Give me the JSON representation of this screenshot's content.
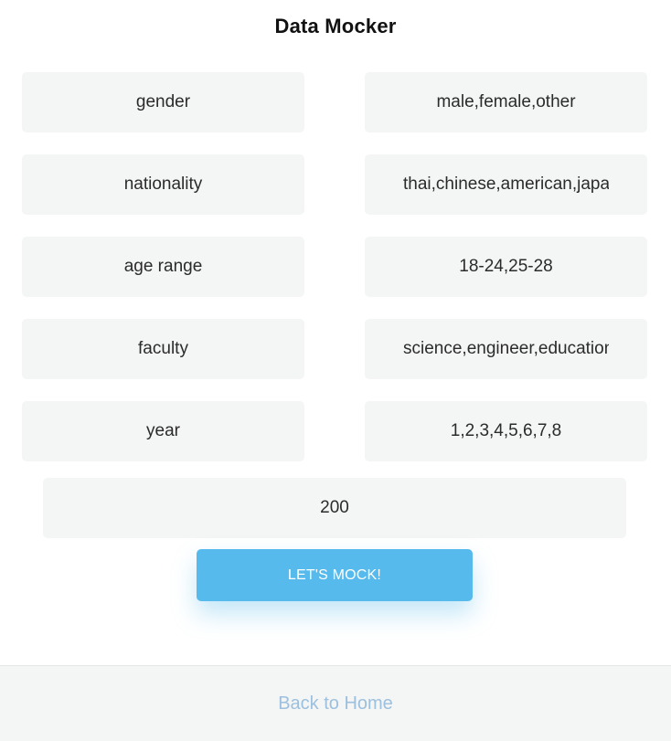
{
  "header": {
    "title": "Data Mocker"
  },
  "fields": [
    {
      "key": "gender",
      "value": "male,female,other"
    },
    {
      "key": "nationality",
      "value": "thai,chinese,american,japanese"
    },
    {
      "key": "age range",
      "value": "18-24,25-28"
    },
    {
      "key": "faculty",
      "value": "science,engineer,education"
    },
    {
      "key": "year",
      "value": "1,2,3,4,5,6,7,8"
    }
  ],
  "count": {
    "value": "200"
  },
  "actions": {
    "mock_label": "LET'S MOCK!"
  },
  "footer": {
    "home_link": "Back to Home"
  },
  "colors": {
    "accent": "#56baec",
    "field_bg": "#f4f5f5",
    "link": "#9cc0dd"
  }
}
